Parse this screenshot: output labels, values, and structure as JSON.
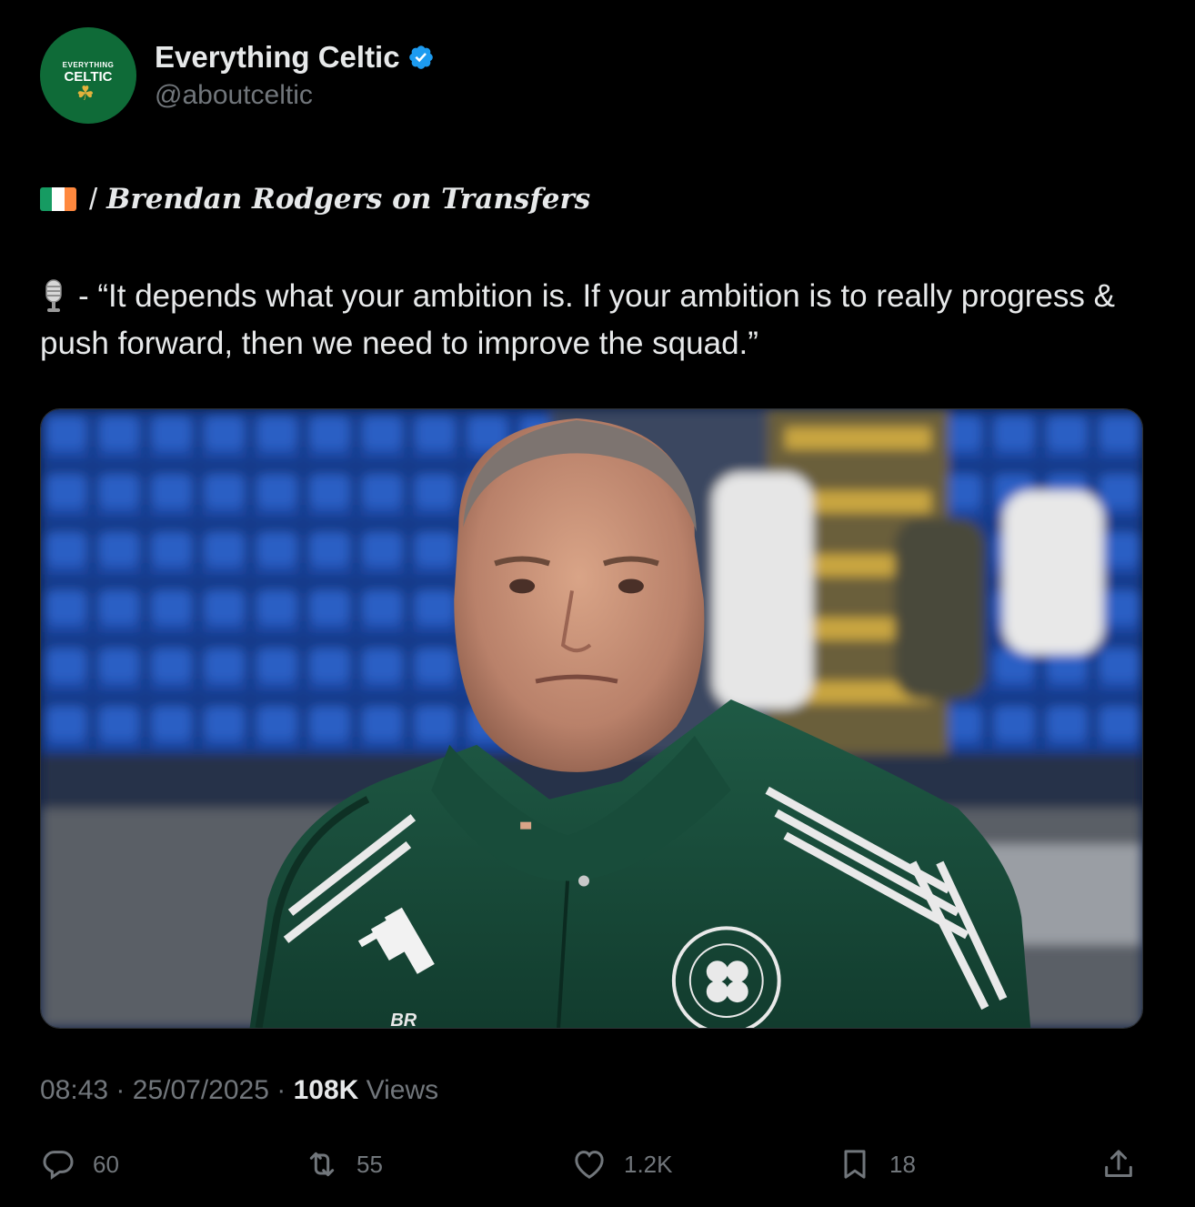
{
  "author": {
    "display_name": "Everything Celtic",
    "handle": "@aboutceltic",
    "verified": true,
    "avatar_text_line1": "EVERYTHING",
    "avatar_text_line2": "CELTIC",
    "avatar_color": "#0f6b38"
  },
  "post": {
    "title_separator": "/",
    "title": "Brendan Rodgers on Transfers",
    "quote_separator": "-",
    "quote": "“It depends what your ambition is. If your ambition is to really progress & push forward, then we need to improve the squad.”",
    "flag_colors": [
      "#169b62",
      "#ffffff",
      "#ff883e"
    ],
    "jacket_text": "BR"
  },
  "meta": {
    "time": "08:43",
    "date": "25/07/2025",
    "views_count": "108K",
    "views_label": "Views",
    "separator": "·"
  },
  "actions": {
    "replies": "60",
    "reposts": "55",
    "likes": "1.2K",
    "bookmarks": "18"
  },
  "colors": {
    "background": "#000000",
    "text_primary": "#e7e9ea",
    "text_secondary": "#71767b",
    "verified_blue": "#1d9bf0"
  }
}
